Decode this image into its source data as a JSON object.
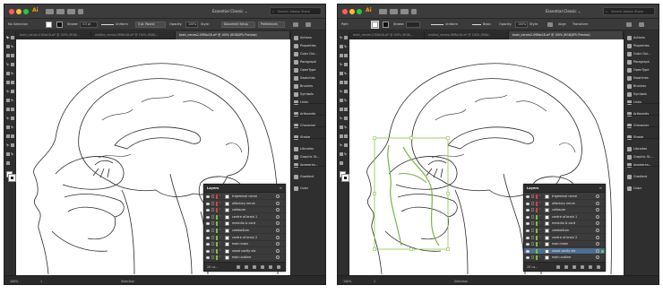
{
  "colors": {
    "accent_selection": "#4b6e92",
    "layer_bar_red": "#d8453b",
    "layer_bar_green": "#79c143",
    "guide_green": "#8bc34a",
    "app_logo_orange": "#ff9a00"
  },
  "windows": [
    {
      "app_logo": "Ai",
      "workspace": "Essential Classic ⌄",
      "search_placeholder": "Search Adobe Stock",
      "control_bar": {
        "selection_label": "No Selection",
        "stroke_label": "Stroke:",
        "stroke_weight": "0.5 pt",
        "stroke_profile": "Uniform",
        "brush": "5 pt. Round",
        "opacity_label": "Opacity:",
        "opacity_value": "100%",
        "style_label": "Style:",
        "doc_setup_button": "Document Setup",
        "preferences_button": "Preferences"
      },
      "tabs": [
        {
          "label": "brain_nerves-01Mar18.ai* @ 100% (RGB/...",
          "active": false
        },
        {
          "label": "midline_nerves-09Mar18.ai* @ 100% (RGB/...",
          "active": false
        },
        {
          "label": "brain_nerves2-09Mar18.ai* @ 100% (RGB/GPU Preview)",
          "active": true
        }
      ],
      "status": {
        "zoom": "100%",
        "artboard": "1",
        "mode": "Selection"
      },
      "layers": {
        "tab_label": "Layers",
        "count_label": "20 La...",
        "items": [
          {
            "name": "trigeminal nerve",
            "color": "red",
            "selected": false
          },
          {
            "name": "olfactory nerve",
            "color": "red",
            "selected": false
          },
          {
            "name": "callosum",
            "color": "red",
            "selected": false
          },
          {
            "name": "centre of brain 1",
            "color": "green",
            "selected": false
          },
          {
            "name": "medulla & cord",
            "color": "green",
            "selected": false
          },
          {
            "name": "cerebellum",
            "color": "green",
            "selected": false
          },
          {
            "name": "centre of brain 2",
            "color": "green",
            "selected": false
          },
          {
            "name": "main brain",
            "color": "green",
            "selected": false
          },
          {
            "name": "nasal cavity etc",
            "color": "green",
            "selected": false
          },
          {
            "name": "main outline",
            "color": "green",
            "selected": false
          }
        ]
      }
    },
    {
      "app_logo": "Ai",
      "workspace": "Essential Classic ⌄",
      "search_placeholder": "Search Adobe Stock",
      "control_bar": {
        "selection_label": "Path",
        "stroke_label": "Stroke:",
        "stroke_weight": "",
        "stroke_profile": "Uniform",
        "brush": "Basic",
        "opacity_label": "Opacity:",
        "opacity_value": "100%",
        "style_label": "Style:",
        "align_button": "Align",
        "transform_button": "Transform"
      },
      "tabs": [
        {
          "label": "brain_nerves-01Mar18.ai* @ 100% (RGB/...",
          "active": false
        },
        {
          "label": "midline_nerves-09Mar18.ai* @ 100% (RGB/...",
          "active": false
        },
        {
          "label": "brain_nerves2-09Mar18.ai* @ 100% (RGB/GPU Preview)",
          "active": true
        }
      ],
      "status": {
        "zoom": "100%",
        "artboard": "1",
        "mode": "Selection"
      },
      "layers": {
        "tab_label": "Layers",
        "count_label": "20 La...",
        "items": [
          {
            "name": "trigeminal nerve",
            "color": "red",
            "selected": false
          },
          {
            "name": "olfactory nerve",
            "color": "red",
            "selected": false
          },
          {
            "name": "callosum",
            "color": "red",
            "selected": false
          },
          {
            "name": "centre of brain 1",
            "color": "green",
            "selected": false
          },
          {
            "name": "medulla & cord",
            "color": "green",
            "selected": false
          },
          {
            "name": "cerebellum",
            "color": "green",
            "selected": false
          },
          {
            "name": "centre of brain 2",
            "color": "green",
            "selected": false
          },
          {
            "name": "main brain",
            "color": "green",
            "selected": false
          },
          {
            "name": "nasal cavity etc",
            "color": "green",
            "selected": true
          },
          {
            "name": "main outline",
            "color": "green",
            "selected": false
          }
        ]
      }
    }
  ],
  "dock": [
    {
      "label": "Actions",
      "icon": "actions-icon"
    },
    {
      "label": "Properties",
      "icon": "properties-icon"
    },
    {
      "label": "Color Gui...",
      "icon": "color-guide-icon"
    },
    {
      "label": "Paragraph",
      "icon": "paragraph-icon"
    },
    {
      "label": "OpenType",
      "icon": "opentype-icon"
    },
    {
      "label": "Swatches",
      "icon": "swatches-icon"
    },
    {
      "label": "Brushes",
      "icon": "brushes-icon"
    },
    {
      "label": "Symbols",
      "icon": "symbols-icon"
    },
    {
      "label": "Links",
      "icon": "links-icon"
    },
    {
      "label": "Artboards",
      "icon": "artboards-icon"
    },
    {
      "label": "Character",
      "icon": "character-icon"
    },
    {
      "label": "Stroke",
      "icon": "stroke-icon"
    },
    {
      "label": "Libraries",
      "icon": "libraries-icon"
    },
    {
      "label": "Graphic St...",
      "icon": "graphic-styles-icon"
    },
    {
      "label": "Appearan...",
      "icon": "appearance-icon"
    },
    {
      "label": "Gradient",
      "icon": "gradient-icon"
    },
    {
      "label": "Color",
      "icon": "color-icon"
    }
  ]
}
